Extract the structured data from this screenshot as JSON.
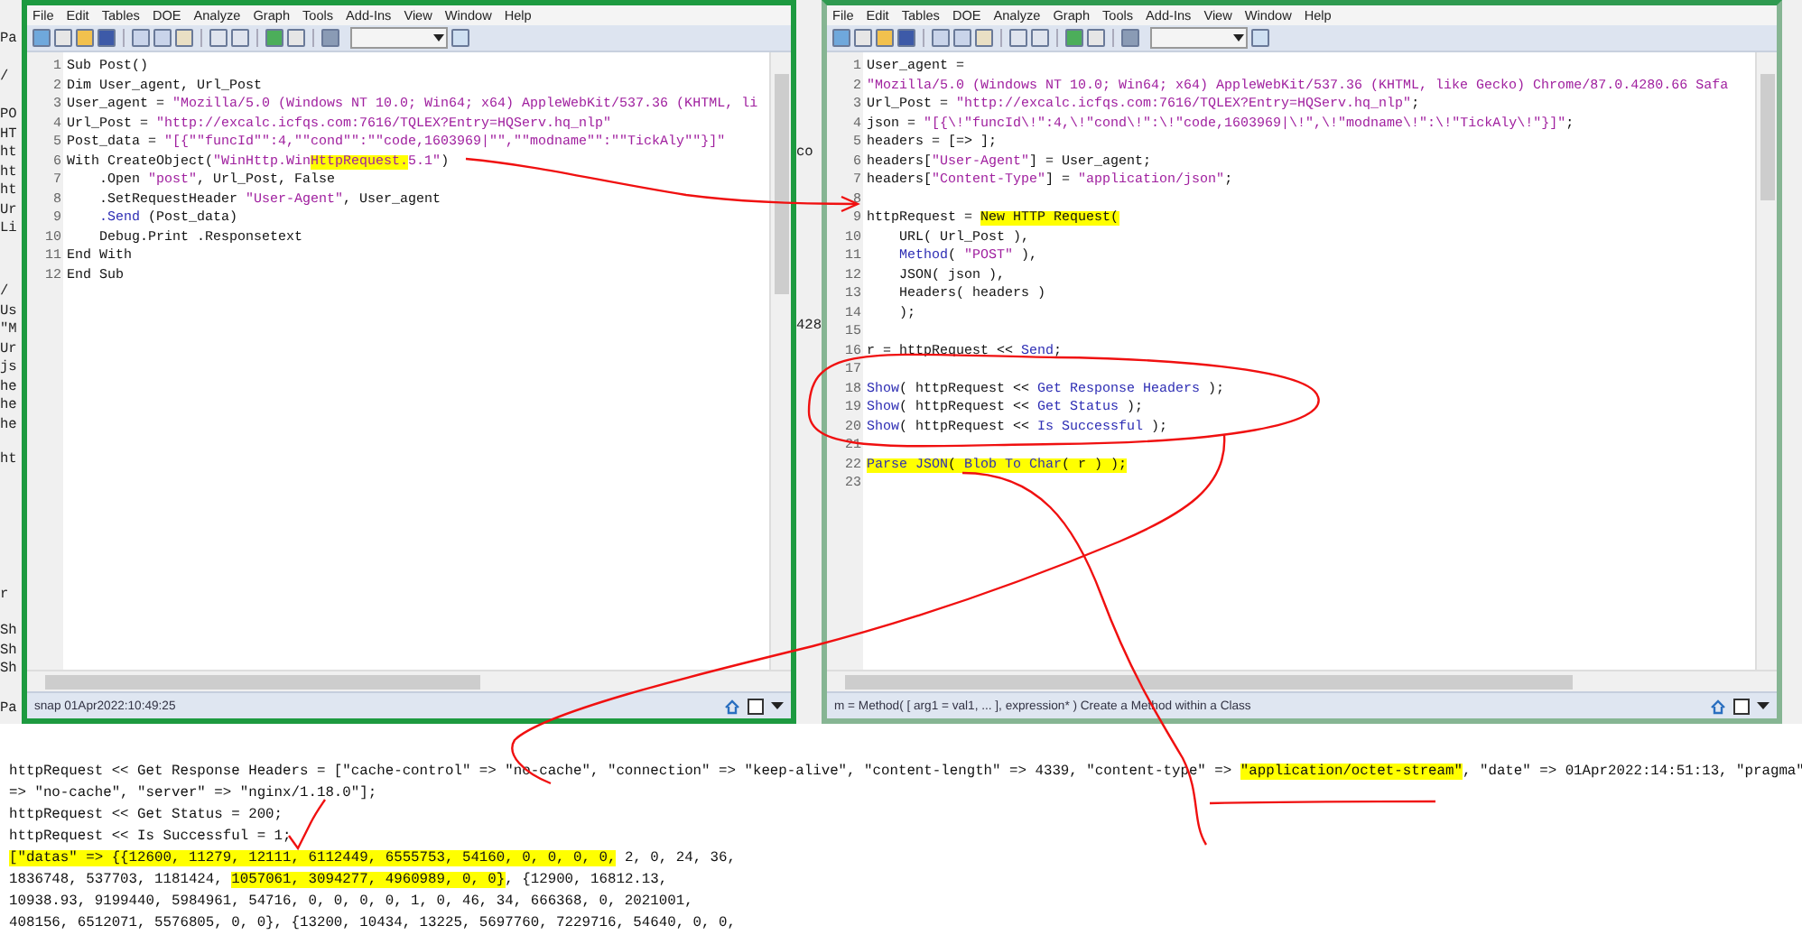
{
  "background_window": {
    "left_fragments": [
      [
        "Pa"
      ],
      [
        "/"
      ],
      [
        "PO",
        "HT",
        "ht",
        "ht",
        "ht",
        "Ur",
        "Li"
      ],
      [
        "/",
        "Us",
        "\"M",
        "Ur",
        "js",
        "he",
        "he",
        "he"
      ],
      [
        "ht"
      ],
      [
        "r"
      ],
      [
        "Sh",
        "Sh",
        "Sh"
      ],
      [
        "Pa"
      ]
    ],
    "middle_fragments": [
      "co",
      "428"
    ]
  },
  "windows": [
    {
      "active": true,
      "menu": [
        "File",
        "Edit",
        "Tables",
        "DOE",
        "Analyze",
        "Graph",
        "Tools",
        "Add-Ins",
        "View",
        "Window",
        "Help"
      ],
      "status": "snap 01Apr2022:10:49:25",
      "lines": [
        {
          "n": "1",
          "segs": [
            {
              "t": "Sub Post()",
              "kind": "plain"
            }
          ]
        },
        {
          "n": "2",
          "segs": [
            {
              "t": "Dim User_agent, Url_Post",
              "kind": "plain"
            }
          ]
        },
        {
          "n": "3",
          "segs": [
            {
              "t": "User_agent = ",
              "kind": "plain"
            },
            {
              "t": "\"Mozilla/5.0 (Windows NT 10.0; Win64; x64) AppleWebKit/537.36 (KHTML, li",
              "kind": "string"
            }
          ]
        },
        {
          "n": "4",
          "segs": [
            {
              "t": "Url_Post = ",
              "kind": "plain"
            },
            {
              "t": "\"http://excalc.icfqs.com:7616/TQLEX?Entry=HQServ.hq_nlp\"",
              "kind": "string"
            }
          ]
        },
        {
          "n": "5",
          "segs": [
            {
              "t": "Post_data = ",
              "kind": "plain"
            },
            {
              "t": "\"[{\"\"funcId\"\":4,\"\"cond\"\":\"\"code,1603969|\"\",\"\"modname\"\":\"\"TickAly\"\"}]\"",
              "kind": "string"
            }
          ]
        },
        {
          "n": "6",
          "segs": [
            {
              "t": "With CreateObject(",
              "kind": "plain"
            },
            {
              "t": "\"WinHttp.Win",
              "kind": "string"
            },
            {
              "t": "HttpRequest.",
              "kind": "highlight_string"
            },
            {
              "t": "5.1\"",
              "kind": "string"
            },
            {
              "t": ")",
              "kind": "plain"
            }
          ]
        },
        {
          "n": "7",
          "indented": true,
          "segs": [
            {
              "t": ".Open ",
              "kind": "plain"
            },
            {
              "t": "\"post\"",
              "kind": "string"
            },
            {
              "t": ", Url_Post, False",
              "kind": "plain"
            }
          ]
        },
        {
          "n": "8",
          "indented": true,
          "segs": [
            {
              "t": ".SetRequestHeader ",
              "kind": "plain"
            },
            {
              "t": "\"User-Agent\"",
              "kind": "string"
            },
            {
              "t": ", User_agent",
              "kind": "plain"
            }
          ]
        },
        {
          "n": "9",
          "indented": true,
          "segs": [
            {
              "t": ".Send",
              "kind": "keyword"
            },
            {
              "t": " (Post_data)",
              "kind": "plain"
            }
          ]
        },
        {
          "n": "10",
          "indented": true,
          "segs": [
            {
              "t": "Debug.Print .Responsetext",
              "kind": "plain"
            }
          ]
        },
        {
          "n": "11",
          "segs": [
            {
              "t": "End With",
              "kind": "plain"
            }
          ]
        },
        {
          "n": "12",
          "segs": [
            {
              "t": "End Sub",
              "kind": "plain"
            }
          ]
        }
      ]
    },
    {
      "active": false,
      "menu": [
        "File",
        "Edit",
        "Tables",
        "DOE",
        "Analyze",
        "Graph",
        "Tools",
        "Add-Ins",
        "View",
        "Window",
        "Help"
      ],
      "status": "m = Method( [ arg1 = val1, ... ], expression* )  Create a Method within a Class",
      "lines": [
        {
          "n": "1",
          "segs": [
            {
              "t": "User_agent =",
              "kind": "plain"
            }
          ]
        },
        {
          "n": "2",
          "segs": [
            {
              "t": "\"Mozilla/5.0 (Windows NT 10.0; Win64; x64) AppleWebKit/537.36 (KHTML, like Gecko) Chrome/87.0.4280.66 Safa",
              "kind": "string"
            }
          ]
        },
        {
          "n": "3",
          "segs": [
            {
              "t": "Url_Post = ",
              "kind": "plain"
            },
            {
              "t": "\"http://excalc.icfqs.com:7616/TQLEX?Entry=HQServ.hq_nlp\"",
              "kind": "string"
            },
            {
              "t": ";",
              "kind": "plain"
            }
          ]
        },
        {
          "n": "4",
          "segs": [
            {
              "t": "json = ",
              "kind": "plain"
            },
            {
              "t": "\"[{\\!\"funcId\\!\":4,\\!\"cond\\!\":\\!\"code,1603969|\\!\",\\!\"modname\\!\":\\!\"TickAly\\!\"}]\"",
              "kind": "string"
            },
            {
              "t": ";",
              "kind": "plain"
            }
          ]
        },
        {
          "n": "5",
          "segs": [
            {
              "t": "headers = [=> ];",
              "kind": "plain"
            }
          ]
        },
        {
          "n": "6",
          "segs": [
            {
              "t": "headers[",
              "kind": "plain"
            },
            {
              "t": "\"User-Agent\"",
              "kind": "string"
            },
            {
              "t": "] = User_agent;",
              "kind": "plain"
            }
          ]
        },
        {
          "n": "7",
          "segs": [
            {
              "t": "headers[",
              "kind": "plain"
            },
            {
              "t": "\"Content-Type\"",
              "kind": "string"
            },
            {
              "t": "] = ",
              "kind": "plain"
            },
            {
              "t": "\"application/json\"",
              "kind": "string"
            },
            {
              "t": ";",
              "kind": "plain"
            }
          ]
        },
        {
          "n": "8"
        },
        {
          "n": "9",
          "segs": [
            {
              "t": "httpRequest = ",
              "kind": "plain"
            },
            {
              "t": "New HTTP Request(",
              "kind": "highlight"
            }
          ]
        },
        {
          "n": "10",
          "indented": true,
          "segs": [
            {
              "t": "URL( Url_Post ),",
              "kind": "plain"
            }
          ]
        },
        {
          "n": "11",
          "indented": true,
          "segs": [
            {
              "t": "Method",
              "kind": "keyword"
            },
            {
              "t": "( ",
              "kind": "plain"
            },
            {
              "t": "\"POST\"",
              "kind": "string"
            },
            {
              "t": " ),",
              "kind": "plain"
            }
          ]
        },
        {
          "n": "12",
          "indented": true,
          "segs": [
            {
              "t": "JSON( json ),",
              "kind": "plain"
            }
          ]
        },
        {
          "n": "13",
          "indented": true,
          "segs": [
            {
              "t": "Headers( headers )",
              "kind": "plain"
            }
          ]
        },
        {
          "n": "14",
          "indented": true,
          "segs": [
            {
              "t": ");",
              "kind": "plain"
            }
          ]
        },
        {
          "n": "15"
        },
        {
          "n": "16",
          "segs": [
            {
              "t": "r = httpRequest << ",
              "kind": "plain"
            },
            {
              "t": "Send",
              "kind": "keyword"
            },
            {
              "t": ";",
              "kind": "plain"
            }
          ]
        },
        {
          "n": "17"
        },
        {
          "n": "18",
          "segs": [
            {
              "t": "Show",
              "kind": "keyword"
            },
            {
              "t": "( httpRequest << ",
              "kind": "plain"
            },
            {
              "t": "Get Response Headers",
              "kind": "keyword"
            },
            {
              "t": " );",
              "kind": "plain"
            }
          ]
        },
        {
          "n": "19",
          "segs": [
            {
              "t": "Show",
              "kind": "keyword"
            },
            {
              "t": "( httpRequest << ",
              "kind": "plain"
            },
            {
              "t": "Get Status",
              "kind": "keyword"
            },
            {
              "t": " );",
              "kind": "plain"
            }
          ]
        },
        {
          "n": "20",
          "segs": [
            {
              "t": "Show",
              "kind": "keyword"
            },
            {
              "t": "( httpRequest << ",
              "kind": "plain"
            },
            {
              "t": "Is Successful",
              "kind": "keyword"
            },
            {
              "t": " );",
              "kind": "plain"
            }
          ]
        },
        {
          "n": "21"
        },
        {
          "n": "22",
          "segs": [
            {
              "t": "Parse JSON",
              "kind": "highlight_keyword"
            },
            {
              "t": "( ",
              "kind": "highlight"
            },
            {
              "t": "Blob To Char",
              "kind": "highlight_keyword"
            },
            {
              "t": "( r ) );",
              "kind": "highlight"
            }
          ]
        },
        {
          "n": "23"
        }
      ]
    }
  ],
  "log": [
    [
      {
        "t": "httpRequest << Get Response Headers = [\"cache-control\" => \"no-cache\", \"connection\" => \"keep-alive\", \"content-length\" => 4339, \"content-type\" => ",
        "kind": "plain"
      },
      {
        "t": "\"application/octet-stream\"",
        "kind": "highlight"
      },
      {
        "t": ", \"date\" => 01Apr2022:14:51:13, \"pragma\"",
        "kind": "plain"
      }
    ],
    [
      {
        "t": "=> \"no-cache\", \"server\" => \"nginx/1.18.0\"];",
        "kind": "plain"
      }
    ],
    [
      {
        "t": "httpRequest << Get Status = 200;",
        "kind": "plain"
      }
    ],
    [
      {
        "t": "httpRequest << Is Successful = 1;",
        "kind": "plain"
      }
    ],
    [
      {
        "t": "[\"datas\" => {{12600, 11279, 12111, 6112449, 6555753, 54160, 0, 0, 0, 0,",
        "kind": "highlight"
      },
      {
        "t": " 2, 0, 24, 36,",
        "kind": "plain"
      }
    ],
    [
      {
        "t": "1836748, 537703, 1181424, ",
        "kind": "plain"
      },
      {
        "t": "1057061, 3094277, 4960989, 0, 0}",
        "kind": "highlight"
      },
      {
        "t": ", {12900, 16812.13,",
        "kind": "plain"
      }
    ],
    [
      {
        "t": "10938.93, 9199440, 5984961, 54716, 0, 0, 0, 0, 1, 0, 46, 34, 666368, 0, 2021001,",
        "kind": "plain"
      }
    ],
    [
      {
        "t": "408156, 6512071, 5576805, 0, 0}, {13200, 10434, 13225, 5697760, 7229716, 54640, 0, 0,",
        "kind": "plain"
      }
    ]
  ]
}
